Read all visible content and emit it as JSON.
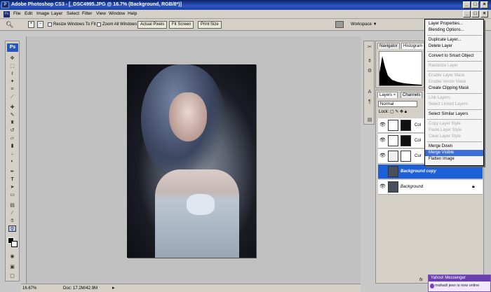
{
  "window": {
    "app_icon": "ps-app-icon",
    "title": "Adobe Photoshop CS3 - [_DSC4995.JPG @ 16.7% (Background, RGB/8*)]",
    "buttons": [
      "_",
      "□",
      "×"
    ],
    "doc_buttons": [
      "_",
      "□",
      "×"
    ]
  },
  "menubar": {
    "items": [
      "File",
      "Edit",
      "Image",
      "Layer",
      "Select",
      "Filter",
      "View",
      "Window",
      "Help"
    ]
  },
  "options": {
    "resize_windows_label": "Resize Windows To Fit",
    "zoom_all_label": "Zoom All Windows",
    "actual_pixels": "Actual Pixels",
    "fit_screen": "Fit Screen",
    "print_size": "Print Size",
    "workspace": "Workspace ▼"
  },
  "toolbox": {
    "logo": "Ps",
    "tools": [
      "move-tool",
      "marquee-tool",
      "lasso-tool",
      "magic-wand-tool",
      "crop-tool",
      "slice-tool",
      "healing-brush-tool",
      "brush-tool",
      "clone-stamp-tool",
      "history-brush-tool",
      "eraser-tool",
      "gradient-tool",
      "blur-tool",
      "dodge-tool",
      "pen-tool",
      "type-tool",
      "path-selection-tool",
      "shape-tool",
      "notes-tool",
      "eyedropper-tool",
      "hand-tool",
      "zoom-tool"
    ]
  },
  "status": {
    "zoom": "16.67%",
    "doc": "Doc: 17.2M/42.9M"
  },
  "panels": {
    "navigator_tab": "Navigator",
    "histogram_tab": "Histogram",
    "layers_tab": "Layers ×",
    "channels_tab": "Channels",
    "blend_mode": "Normal",
    "lock_label": "Lock:",
    "layers": [
      {
        "name": "Col",
        "selected": false,
        "italic": false
      },
      {
        "name": "Col",
        "selected": false,
        "italic": false
      },
      {
        "name": "Cur",
        "selected": false,
        "italic": false
      },
      {
        "name": "Background copy",
        "selected": true,
        "italic": true
      },
      {
        "name": "Background",
        "selected": false,
        "italic": true
      }
    ],
    "bottom_fx": "fx"
  },
  "context_menu": {
    "items": [
      {
        "label": "Layer Properties...",
        "disabled": false,
        "highlight": false
      },
      {
        "label": "Blending Options...",
        "disabled": false,
        "highlight": false
      },
      {
        "sep": true
      },
      {
        "label": "Duplicate Layer...",
        "disabled": false,
        "highlight": false
      },
      {
        "label": "Delete Layer",
        "disabled": false,
        "highlight": false
      },
      {
        "sep": true
      },
      {
        "label": "Convert to Smart Object",
        "disabled": false,
        "highlight": false
      },
      {
        "sep": true
      },
      {
        "label": "Rasterize Layer",
        "disabled": true,
        "highlight": false
      },
      {
        "sep": true
      },
      {
        "label": "Enable Layer Mask",
        "disabled": true,
        "highlight": false
      },
      {
        "label": "Enable Vector Mask",
        "disabled": true,
        "highlight": false
      },
      {
        "label": "Create Clipping Mask",
        "disabled": false,
        "highlight": false
      },
      {
        "sep": true
      },
      {
        "label": "Link Layers",
        "disabled": true,
        "highlight": false
      },
      {
        "label": "Select Linked Layers",
        "disabled": true,
        "highlight": false
      },
      {
        "sep": true
      },
      {
        "label": "Select Similar Layers",
        "disabled": false,
        "highlight": false
      },
      {
        "sep": true
      },
      {
        "label": "Copy Layer Style",
        "disabled": true,
        "highlight": false
      },
      {
        "label": "Paste Layer Style",
        "disabled": true,
        "highlight": false
      },
      {
        "label": "Clear Layer Style",
        "disabled": true,
        "highlight": false
      },
      {
        "sep": true
      },
      {
        "label": "Merge Down",
        "disabled": false,
        "highlight": false
      },
      {
        "label": "Merge Visible",
        "disabled": false,
        "highlight": true
      },
      {
        "label": "Flatten Image",
        "disabled": false,
        "highlight": false
      }
    ]
  },
  "yahoo": {
    "title": "Yahoo! Messenger",
    "message": "mahadi jeen is now online"
  }
}
